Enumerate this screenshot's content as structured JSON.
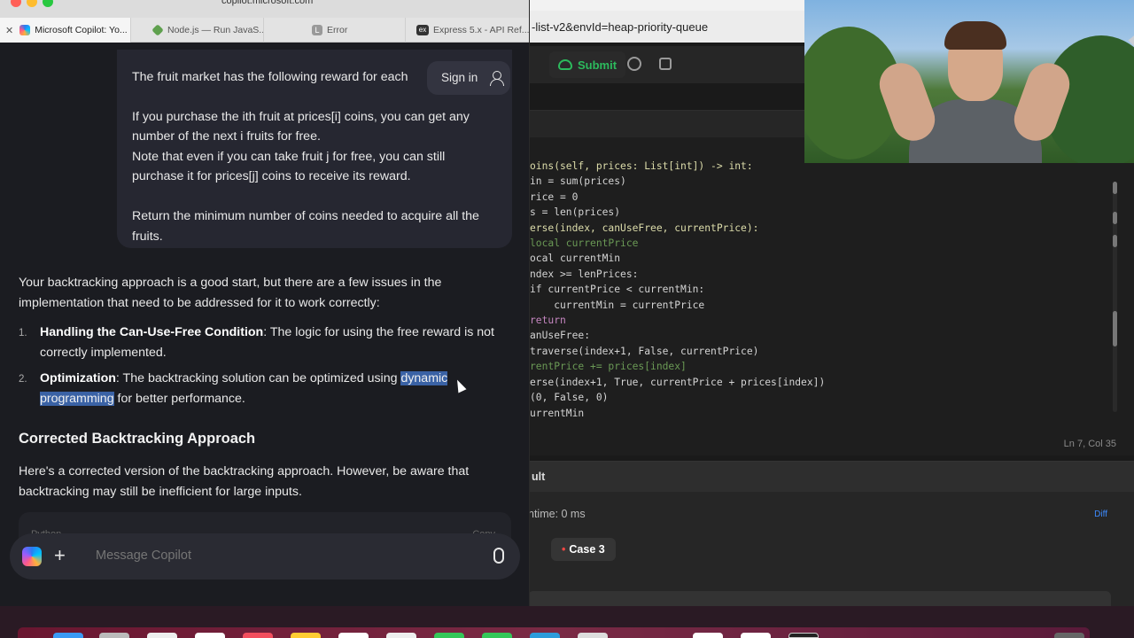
{
  "safari": {
    "url": "copilot.microsoft.com",
    "tabs": [
      {
        "label": "Microsoft Copilot: Yo...",
        "icon": "copilot-icon",
        "active": true
      },
      {
        "label": "Node.js — Run JavaS...",
        "icon": "nodejs-icon"
      },
      {
        "label": "Error",
        "icon": "letter-l-icon",
        "icon_text": "L"
      },
      {
        "label": "Express 5.x - API Ref...",
        "icon": "express-icon",
        "icon_text": "ex"
      }
    ]
  },
  "chat": {
    "signin_label": "Sign in",
    "user_message": {
      "p1": "The fruit market has the following reward for each",
      "p2": "If you purchase the ith fruit at prices[i] coins, you can get any number of the next i fruits for free.",
      "p3": "Note that even if you can take fruit j for free, you can still purchase it for prices[j] coins to receive its reward.",
      "p4": "Return the minimum number of coins needed to acquire all the fruits."
    },
    "answer_intro": "Your backtracking approach is a good start, but there are a few issues in the implementation that need to be addressed for it to work correctly:",
    "list": [
      {
        "num": "1.",
        "title": "Handling the Can-Use-Free Condition",
        "text": ": The logic for using the free reward is not correctly implemented."
      },
      {
        "num": "2.",
        "title": "Optimization",
        "text_before": ": The backtracking solution can be optimized using ",
        "highlight": "dynamic programming",
        "text_after": " for better performance."
      }
    ],
    "heading": "Corrected Backtracking Approach",
    "para": "Here's a corrected version of the backtracking approach. However, be aware that backtracking may still be inefficient for large inputs.",
    "code_lang": "Python",
    "copy_label": "Copy",
    "composer_placeholder": "Message Copilot"
  },
  "leetcode": {
    "url": "-list-v2&envId=heap-priority-queue",
    "submit_label": "Submit",
    "cursor_pos": "Ln 7, Col 35",
    "result_tab": "ult",
    "runtime": "ntime: 0 ms",
    "diff_label": "Diff",
    "case_label": "Case 3",
    "code_lines": [
      "oins(self, prices: List[int]) -> int:",
      "in = sum(prices)",
      "rice = 0",
      "s = len(prices)",
      "erse(index, canUseFree, currentPrice):",
      "local currentPrice",
      "ocal currentMin",
      "ndex >= lenPrices:",
      "if currentPrice < currentMin:",
      "    currentMin = currentPrice",
      "return",
      "anUseFree:",
      "traverse(index+1, False, currentPrice)",
      "rentPrice += prices[index]",
      "erse(index+1, True, currentPrice + prices[index])",
      "(0, False, 0)",
      "urrentMin"
    ]
  },
  "colors": {
    "accent_green": "#2cbb5d",
    "highlight": "#3a62a5",
    "chat_bg": "#1b1c21"
  }
}
